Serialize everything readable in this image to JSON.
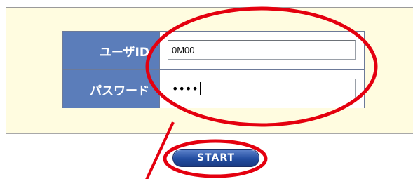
{
  "login_form": {
    "user_id_label": "ユーザID",
    "user_id_value": "0M00",
    "password_label": "パスワード",
    "password_value": "••••"
  },
  "start_button_label": "START",
  "colors": {
    "panel_background": "#fffce0",
    "label_background": "#5b7dba",
    "button_blue": "#234da0",
    "annotation_red": "#e4000f"
  }
}
